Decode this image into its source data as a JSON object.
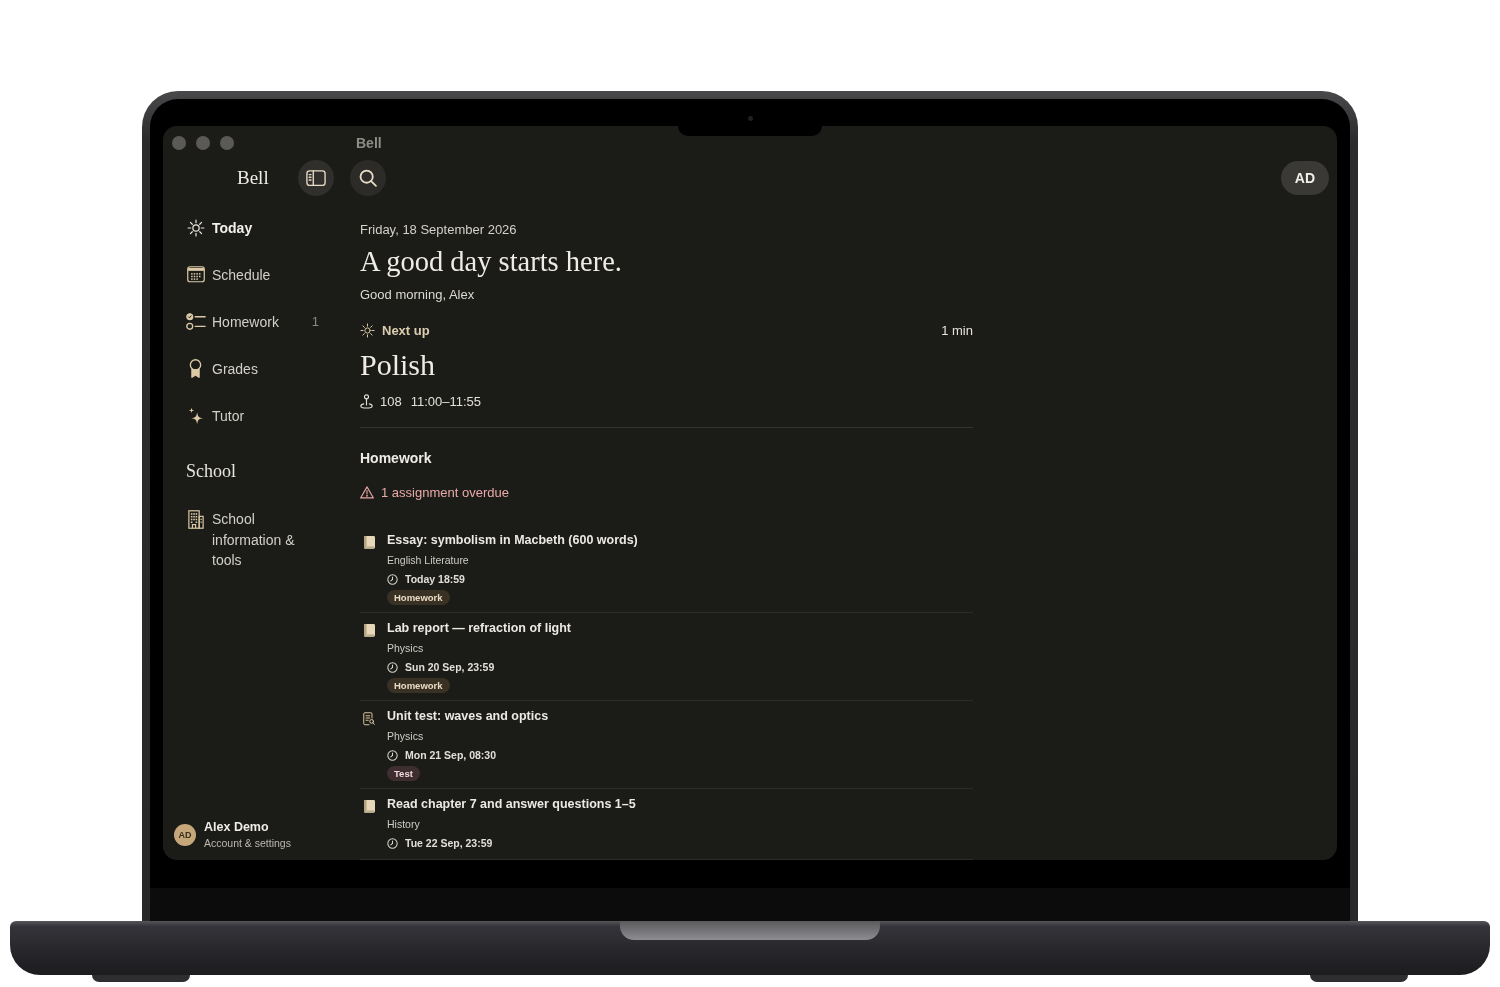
{
  "window": {
    "title": "Bell"
  },
  "toolbar": {
    "app_name": "Bell",
    "profile_initials": "AD"
  },
  "sidebar": {
    "items": [
      {
        "label": "Today",
        "selected": true
      },
      {
        "label": "Schedule",
        "selected": false
      },
      {
        "label": "Homework",
        "selected": false,
        "badge": "1"
      },
      {
        "label": "Grades",
        "selected": false
      },
      {
        "label": "Tutor",
        "selected": false
      }
    ],
    "section": {
      "title": "School",
      "items": [
        {
          "label": "School information & tools",
          "selected": false
        }
      ]
    },
    "account": {
      "initials": "AD",
      "name": "Alex Demo",
      "subtitle": "Account & settings"
    }
  },
  "today": {
    "date": "Friday, 18 September 2026",
    "headline": "A good day starts here.",
    "greeting": "Good morning, Alex"
  },
  "next_up": {
    "label": "Next up",
    "countdown": "1 min",
    "subject": "Polish",
    "room": "108",
    "time": "11:00–11:55"
  },
  "homework": {
    "title": "Homework",
    "alert": "1 assignment overdue",
    "items": [
      {
        "kind": "homework",
        "title": "Essay: symbolism in Macbeth (600 words)",
        "subject": "English Literature",
        "due": "Today 18:59",
        "tag": "Homework"
      },
      {
        "kind": "homework",
        "title": "Lab report — refraction of light",
        "subject": "Physics",
        "due": "Sun 20 Sep, 23:59",
        "tag": "Homework"
      },
      {
        "kind": "test",
        "title": "Unit test: waves and optics",
        "subject": "Physics",
        "due": "Mon 21 Sep, 08:30",
        "tag": "Test"
      },
      {
        "kind": "homework",
        "title": "Read chapter 7 and answer questions 1–5",
        "subject": "History",
        "due": "Tue 22 Sep, 23:59"
      }
    ]
  }
}
